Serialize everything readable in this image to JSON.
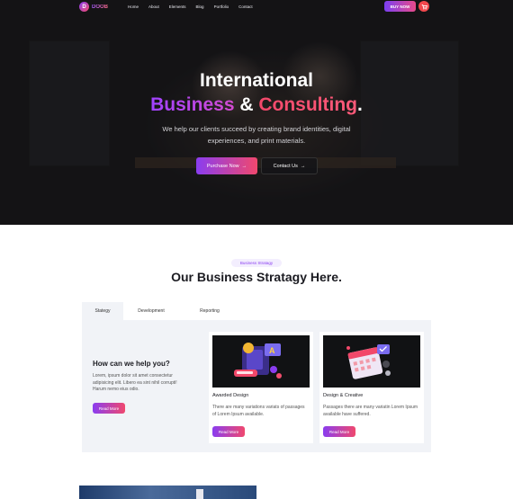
{
  "brand": {
    "name": "DOOB"
  },
  "nav": {
    "items": [
      "Home",
      "About",
      "Elements",
      "Blog",
      "Portfolio",
      "Contact"
    ],
    "buy_label": "BUY NOW"
  },
  "hero": {
    "title_line1": "International",
    "title_word1": "Business",
    "title_amp": "&",
    "title_word2": "Consulting",
    "title_dot": ".",
    "description": "We help our clients succeed by creating brand identities, digital experiences, and print materials.",
    "purchase_label": "Purchase Now",
    "contact_label": "Contact Us"
  },
  "section": {
    "tag": "Business Stratagy",
    "title": "Our Business Stratagy Here."
  },
  "tabs": [
    {
      "label": "Stategy"
    },
    {
      "label": "Development"
    },
    {
      "label": "Reporting"
    }
  ],
  "help": {
    "title": "How can we help you?",
    "description": "Lorem, ipsum dolor sit amet consectetur adipisicing elit. Libero ea sint nihil corrupti! Harum nemo eius odio.",
    "button": "Read More"
  },
  "cards": [
    {
      "title": "Awarded Design",
      "description": "There are many variations variats of passages of Lorem Ipsum available.",
      "button": "Read More"
    },
    {
      "title": "Design & Creative",
      "description": "Passages there are many variatin Lorem Ipsum available have suffered.",
      "button": "Read More"
    }
  ],
  "colors": {
    "accent_start": "#8a3df0",
    "accent_end": "#f0486e",
    "panel": "#f1f3f7"
  },
  "icons": {
    "cart": "cart-icon",
    "arrow": "arrow-right-icon"
  }
}
